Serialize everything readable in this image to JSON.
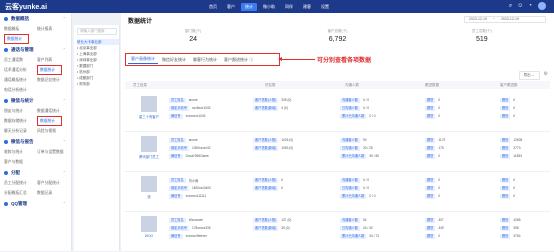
{
  "app": {
    "logo": "云客yunke.ai",
    "nav": [
      "首页",
      "客户",
      "统计",
      "微小助",
      "同伴",
      "建客",
      "设置"
    ],
    "nav_active_index": 2,
    "accent": "#2f6be0",
    "topbar_color": "#1d3a8a"
  },
  "sidebar": {
    "sections": [
      {
        "title": "数据概括",
        "rows": [
          [
            "数据概括",
            "统计报表"
          ],
          [
            "数据统计",
            ""
          ]
        ]
      },
      {
        "title": "通话与管理",
        "rows": [
          [
            "员工通话数",
            "客户列表"
          ],
          [
            "话术通话分析",
            "数据统计"
          ],
          [
            "通话概括统计",
            "数据记忆统计"
          ],
          [
            "电话分析统计",
            ""
          ]
        ]
      },
      {
        "title": "微信与统计",
        "rows": [
          [
            "朋友与统计",
            "数据通话统计"
          ],
          [
            "数据存储统计",
            "数据统计"
          ],
          [
            "聊天分析记录",
            "风险与视频"
          ]
        ]
      },
      {
        "title": "微信与报告",
        "rows": [
          [
            "收款与统计",
            "订单与设置数据"
          ],
          [
            "客户与数据",
            ""
          ]
        ]
      },
      {
        "title": "分配",
        "rows": [
          [
            "员工分配统计",
            "客户分配统计"
          ],
          [
            "分配概括汇总",
            "数据记录"
          ]
        ]
      },
      {
        "title": "QQ管理",
        "rows": []
      }
    ],
    "selected_item": "数据统计"
  },
  "tree": {
    "search_placeholder": "请输入部门搜索",
    "items": [
      "研业大卡事业部",
      "• 北京事业部",
      "• 上海事业部",
      "• 深圳事业部",
      "• 数据部门",
      "• 杭州部",
      "• 成都部门",
      "• 财务部"
    ]
  },
  "main": {
    "title": "数据统计",
    "date_from": "2023-12-19",
    "date_sep": "~",
    "date_to": "2023-12-19",
    "stats": [
      {
        "label": "部门数(个)",
        "value": "24"
      },
      {
        "label": "客户总数(个)",
        "value": "6,792"
      },
      {
        "label": "员工总数(个)",
        "value": "519"
      }
    ],
    "tabs": [
      "客户画像统计",
      "微信好友统计",
      "聊客行为统计",
      "客户跟进统计 ⓘ"
    ],
    "active_tab": 0,
    "annotation": "可分别查看各项数据",
    "export_label": "导出 ⌄",
    "table_headers": [
      "员工信息",
      "",
      "好友数",
      "",
      "沟通人数",
      "",
      "跟进数据",
      "",
      "客户跟进数"
    ],
    "rows": [
      {
        "name": "星三十有客户",
        "info": [
          [
            "员工姓名",
            "anone"
          ],
          [
            "绑定手机号",
            "xxx8xxx1043"
          ],
          [
            "微信号",
            "xxxxxxxx1043"
          ]
        ],
        "friends": [
          [
            "客户总数(人数)",
            "339 (0)"
          ],
          [
            "客户总数(新增)",
            "4 (0)"
          ]
        ],
        "comm": [
          [
            "沟通客人数",
            "0 / 0"
          ],
          [
            "已沟通人数",
            "0 / 0"
          ],
          [
            "累计已沟通人数",
            "0 / 0"
          ]
        ],
        "follow": [
          [
            "跟进",
            "0"
          ],
          [
            "跟进",
            "0"
          ],
          [
            "跟进",
            "0"
          ]
        ],
        "track": [
          [
            "跟进",
            "0"
          ],
          [
            "跟进",
            "0"
          ],
          [
            "跟进",
            "0"
          ]
        ]
      },
      {
        "name": "腾讯部门员工",
        "info": [
          [
            "员工姓名",
            "anone"
          ],
          [
            "绑定手机号",
            "1390xxxxx32"
          ],
          [
            "微信号",
            "Dova1996Game"
          ]
        ],
        "friends": [
          [
            "客户总数(人数)",
            "1026 (0)"
          ],
          [
            "客户总数(新增)",
            "1053 (0)"
          ]
        ],
        "comm": [
          [
            "沟通客人数",
            "90"
          ],
          [
            "已沟通人数",
            "30 / 25"
          ],
          [
            "累计已沟通人数",
            "90 / 80"
          ]
        ],
        "follow": [
          [
            "跟进",
            "1179"
          ],
          [
            "跟进",
            "175"
          ],
          [
            "跟进",
            "0"
          ]
        ],
        "track": [
          [
            "跟进",
            "12605"
          ],
          [
            "跟进",
            "2773"
          ],
          [
            "跟进",
            "11853"
          ]
        ]
      },
      {
        "name": "张",
        "info": [
          [
            "员工姓名",
            "刘小雨"
          ],
          [
            "绑定手机号",
            "1820xxx3400"
          ],
          [
            "微信号",
            "xxxxxxx111111"
          ]
        ],
        "friends": [
          [
            "客户总数(人数)",
            "0"
          ],
          [
            "客户总数(新增)",
            "0"
          ]
        ],
        "comm": [
          [
            "沟通客人数",
            "0 / 0"
          ],
          [
            "已沟通人数",
            "0 / 0"
          ],
          [
            "累计已沟通人数",
            "0 / 0"
          ]
        ],
        "follow": [
          [
            "跟进",
            "0"
          ],
          [
            "跟进",
            "0"
          ],
          [
            "跟进",
            "0"
          ]
        ],
        "track": [
          [
            "跟进",
            "0"
          ],
          [
            "跟进",
            "0"
          ],
          [
            "跟进",
            "0"
          ]
        ]
      },
      {
        "name": "WOO",
        "info": [
          [
            "员工姓名",
            "Wxxxxwei"
          ],
          [
            "绑定手机号",
            "178xxxxx335"
          ],
          [
            "微信号",
            "xxxxxxx9eterer"
          ]
        ],
        "friends": [
          [
            "客户总数(人数)",
            "137 (0)"
          ],
          [
            "客户总数(新增)",
            "39 (0)"
          ]
        ],
        "comm": [
          [
            "沟通客人数",
            "54"
          ],
          [
            "已沟通人数",
            "24 / 40"
          ],
          [
            "累计已沟通人数",
            "54 / 73"
          ]
        ],
        "follow": [
          [
            "跟进",
            "307"
          ],
          [
            "跟进",
            "349"
          ],
          [
            "跟进",
            "0"
          ]
        ],
        "track": [
          [
            "跟进",
            "4285"
          ],
          [
            "跟进",
            "398"
          ],
          [
            "跟进",
            "3754"
          ]
        ]
      }
    ]
  }
}
